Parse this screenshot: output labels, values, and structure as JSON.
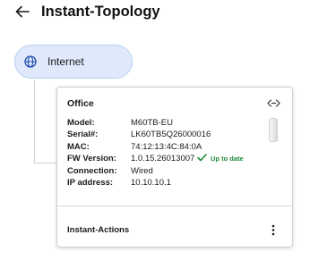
{
  "header": {
    "title": "Instant-Topology",
    "back_icon": "arrow-left-icon"
  },
  "internet_node": {
    "label": "Internet",
    "icon": "globe-icon",
    "accent_color": "#1f4fb0",
    "background_color": "#dfe9fb"
  },
  "device": {
    "name": "Office",
    "expand_icon": "expand-arrows-icon",
    "details": [
      {
        "label": "Model:",
        "value": "M60TB-EU"
      },
      {
        "label": "Serial#:",
        "value": "LK60TB5Q26000016"
      },
      {
        "label": "MAC:",
        "value": "74:12:13:4C:84:0A"
      },
      {
        "label": "FW Version:",
        "value": "1.0.15.26013007"
      },
      {
        "label": "Connection:",
        "value": "Wired"
      },
      {
        "label": "IP address:",
        "value": "10.10.10.1"
      }
    ],
    "firmware_status": {
      "text": "Up to date",
      "icon": "check-icon",
      "color": "#1e8a3a"
    },
    "actions": {
      "label": "Instant-Actions",
      "menu_icon": "kebab-menu-icon"
    }
  }
}
